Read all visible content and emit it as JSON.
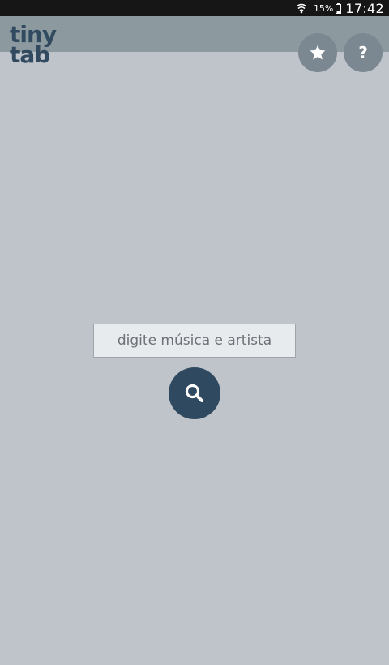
{
  "status_bar": {
    "battery_percent": "15%",
    "time": "17:42",
    "wifi_icon": "wifi-icon",
    "battery_icon": "battery-icon"
  },
  "app": {
    "logo_line1": "tiny",
    "logo_line2": "tab"
  },
  "header": {
    "favorites_icon": "star-icon",
    "help_label": "?"
  },
  "search": {
    "placeholder": "digite música e artista",
    "value": "",
    "button_icon": "search-icon"
  },
  "colors": {
    "background": "#bfc4cb",
    "header_band": "#8c9a9f",
    "accent": "#2f4a60",
    "round_button": "#7b8791"
  }
}
